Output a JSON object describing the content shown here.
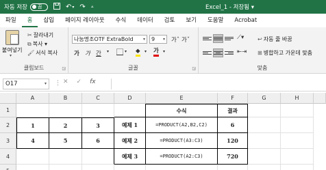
{
  "titlebar": {
    "autosave_label": "자동 저장",
    "autosave_state": "끔",
    "doc_title": "Excel_1 - 저장됨 ▾"
  },
  "tabs": [
    "파일",
    "홈",
    "삽입",
    "페이지 레이아웃",
    "수식",
    "데이터",
    "검토",
    "보기",
    "도움말",
    "Acrobat"
  ],
  "active_tab": "홈",
  "ribbon": {
    "clipboard": {
      "paste_label": "붙여넣기",
      "cut_label": "잘라내기",
      "copy_label": "복사 ▾",
      "format_painter_label": "서식 복사",
      "group_label": "클립보드"
    },
    "font": {
      "font_name": "나눔명조OTF ExtraBold",
      "font_size": "9",
      "grow_label": "가ˆ",
      "shrink_label": "가ˇ",
      "bold_label": "가",
      "italic_label": "가",
      "underline_label": "간",
      "fill_color_label": "◆",
      "font_color_label": "가",
      "group_label": "글꼴"
    },
    "alignment": {
      "wrap_label": "자동 줄 바꿈",
      "merge_label": "병합하고 가운데 맞춤",
      "group_label": "맞춤"
    }
  },
  "formula_bar": {
    "name_box": "O17",
    "cancel": "✕",
    "enter": "✓",
    "fx": "fx",
    "content": ""
  },
  "sheet": {
    "columns": [
      "A",
      "B",
      "C",
      "D",
      "E",
      "F",
      "G",
      "H"
    ],
    "rows": [
      "1",
      "2",
      "3",
      "4",
      "5"
    ],
    "cells": {
      "E1": "수식",
      "F1": "결과",
      "A2": "1",
      "B2": "2",
      "C2": "3",
      "D2": "예제 1",
      "E2": "=PRODUCT(A2,B2,C2)",
      "F2": "6",
      "A3": "4",
      "B3": "5",
      "C3": "6",
      "D3": "예제 2",
      "E3": "=PRODUCT(A3:C3)",
      "F3": "120",
      "D4": "예제 3",
      "E4": "=PRODUCT(A2:C3)",
      "F4": "720"
    }
  }
}
